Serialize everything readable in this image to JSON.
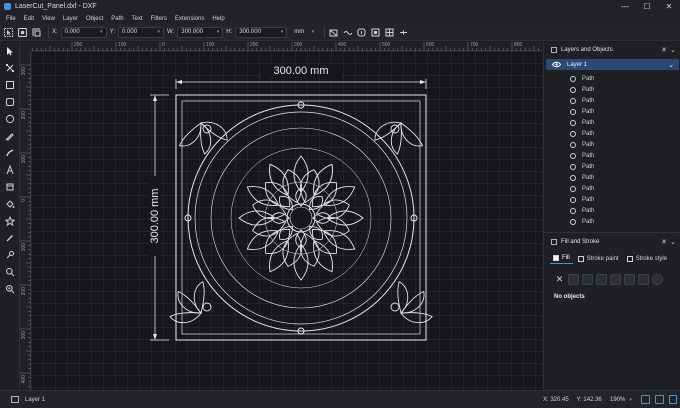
{
  "window": {
    "title": "LaserCut_Panel.dxf - DXF",
    "controls": [
      "—",
      "☐",
      "✕"
    ]
  },
  "menu": [
    "File",
    "Edit",
    "View",
    "Layer",
    "Object",
    "Path",
    "Text",
    "Filters",
    "Extensions",
    "Help"
  ],
  "toolbar": {
    "x_label": "X:",
    "x_value": "0.000",
    "y_label": "Y:",
    "y_value": "0.000",
    "w_label": "W:",
    "w_value": "300.000",
    "h_label": "H:",
    "h_value": "300.000",
    "unit": "mm",
    "icons": [
      "select-all-icon",
      "select-touch-icon",
      "transform-icon",
      "lock-ratio-icon",
      "scale-stroke-icon",
      "scale-corners-icon",
      "move-gradient-icon",
      "move-pattern-icon",
      "more-icon"
    ]
  },
  "tools": [
    "selector-icon",
    "node-icon",
    "rectangle-icon",
    "square-icon",
    "circle-icon",
    "pen-icon",
    "calligraphy-icon",
    "text-icon",
    "spray-icon",
    "bucket-icon",
    "star-icon",
    "pencil-icon",
    "dropper-icon",
    "zoom-icon",
    "measure-icon"
  ],
  "rulers": {
    "top": [
      "300",
      "200",
      "100",
      "0",
      "100",
      "200",
      "300",
      "400",
      "500",
      "600",
      "700",
      "800"
    ],
    "left": [
      "300",
      "200",
      "100",
      "0",
      "100",
      "200",
      "300",
      "400",
      "500"
    ]
  },
  "canvas": {
    "width_dimension": "300.00 mm",
    "height_dimension": "300.00 mm"
  },
  "layers_panel": {
    "title": "Layers and Objects",
    "layer_name": "Layer 1",
    "objects": [
      "Path",
      "Path",
      "Path",
      "Path",
      "Path",
      "Path",
      "Path",
      "Path",
      "Path",
      "Path",
      "Path",
      "Path",
      "Path",
      "Path"
    ]
  },
  "fill_panel": {
    "title": "Fill and Stroke",
    "tabs": [
      "Fill",
      "Stroke paint",
      "Stroke style"
    ],
    "empty_message": "No objects"
  },
  "status": {
    "layer": "Layer 1",
    "x_label": "X:",
    "x_value": "320.45",
    "y_label": "Y:",
    "y_value": "142.36",
    "zoom": "190%"
  },
  "colors": {
    "accent": "#4a90e2",
    "selected_row": "#2a4a75",
    "artwork": "#e6e6e6",
    "background": "#15171a"
  }
}
